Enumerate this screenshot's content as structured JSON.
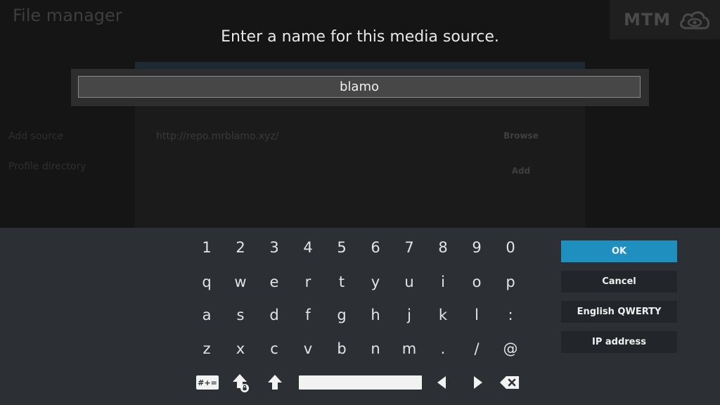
{
  "background": {
    "title": "File manager",
    "logo_text": "MTM",
    "sidebar": [
      "Add source",
      "Profile directory"
    ],
    "url": "http://repo.mrblamo.xyz/",
    "browse_label": "Browse",
    "add_label": "Add"
  },
  "dialog": {
    "heading": "Enter a name for this media source.",
    "input_value": "blamo"
  },
  "keyboard": {
    "rows": [
      [
        "1",
        "2",
        "3",
        "4",
        "5",
        "6",
        "7",
        "8",
        "9",
        "0"
      ],
      [
        "q",
        "w",
        "e",
        "r",
        "t",
        "y",
        "u",
        "i",
        "o",
        "p"
      ],
      [
        "a",
        "s",
        "d",
        "f",
        "g",
        "h",
        "j",
        "k",
        "l",
        ":"
      ],
      [
        "z",
        "x",
        "c",
        "v",
        "b",
        "n",
        "m",
        ".",
        "/",
        "@"
      ]
    ],
    "symbols_label": "#+="
  },
  "buttons": {
    "ok": "OK",
    "cancel": "Cancel",
    "layout": "English QWERTY",
    "ip": "IP address"
  },
  "colors": {
    "accent": "#1f8fc0",
    "panel": "#2c3034",
    "button": "#22262a"
  }
}
